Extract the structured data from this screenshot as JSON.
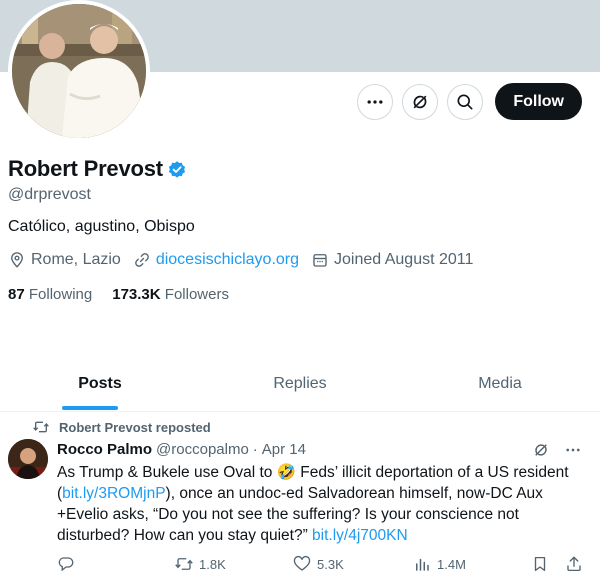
{
  "profile": {
    "display_name": "Robert Prevost",
    "handle": "@drprevost",
    "bio": "Católico, agustino, Obispo",
    "location": "Rome, Lazio",
    "website": "diocesischiclayo.org",
    "joined": "Joined August 2011",
    "following_count": "87",
    "following_label": "Following",
    "followers_count": "173.3K",
    "followers_label": "Followers",
    "verified": true
  },
  "actions": {
    "more_icon": "more-icon",
    "grok_icon": "grok-icon",
    "search_icon": "search-icon",
    "follow_label": "Follow"
  },
  "tabs": [
    {
      "label": "Posts",
      "active": true
    },
    {
      "label": "Replies",
      "active": false
    },
    {
      "label": "Media",
      "active": false
    }
  ],
  "post": {
    "repost_label": "Robert Prevost reposted",
    "author": "Rocco Palmo",
    "author_handle": "@roccopalmo",
    "sep": "·",
    "date": "Apr 14",
    "text_part1": "As Trump & Bukele use Oval to ",
    "emoji": "🤣",
    "text_part2": " Feds’ illicit deportation of a US resident (",
    "link1": "bit.ly/3ROMjnP",
    "text_part3": "), once an undoc-ed Salvadorean himself, now-DC Aux +Evelio asks, “Do you not see the suffering? Is your conscience not disturbed? How can you stay quiet?” ",
    "link2": "bit.ly/4j700KN",
    "reposts": "1.8K",
    "likes": "5.3K",
    "views": "1.4M"
  },
  "colors": {
    "accent": "#1d9bf0",
    "text": "#0f1419",
    "secondary": "#536471",
    "banner": "#cfd9de"
  }
}
